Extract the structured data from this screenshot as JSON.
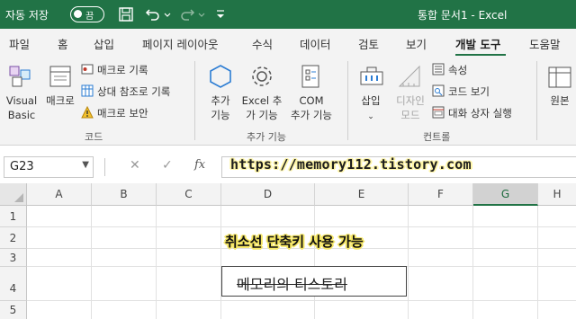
{
  "titlebar": {
    "autosave_label": "자동 저장",
    "toggle_state": "끔",
    "doc_title": "통합 문서1  -  Excel"
  },
  "tabs": [
    "파일",
    "홈",
    "삽입",
    "페이지 레이아웃",
    "수식",
    "데이터",
    "검토",
    "보기",
    "개발 도구",
    "도움말"
  ],
  "active_tab": "개발 도구",
  "ribbon": {
    "code": {
      "visual_basic": "Visual\nBasic",
      "macro": "매크로",
      "record_macro": "매크로 기록",
      "relative_ref": "상대 참조로 기록",
      "macro_security": "매크로 보안",
      "group_label": "코드"
    },
    "addins": {
      "addins": "추가\n기능",
      "excel_addins": "Excel 추\n가 기능",
      "com_addins": "COM\n추가 기능",
      "group_label": "추가 기능"
    },
    "controls": {
      "insert": "삽입",
      "design_mode": "디자인\n모드",
      "properties": "속성",
      "view_code": "코드 보기",
      "run_dialog": "대화 상자 실행",
      "group_label": "컨트롤"
    },
    "source": {
      "label": "원본"
    }
  },
  "formula_bar": {
    "name_box": "G23",
    "fx": "fx",
    "watermark": "https://memory112.tistory.com"
  },
  "sheet": {
    "columns": [
      "A",
      "B",
      "C",
      "D",
      "E",
      "F",
      "G",
      "H"
    ],
    "selected_column": "G",
    "rows": [
      "1",
      "2",
      "3",
      "4",
      "5"
    ],
    "caption": "취소선 단축키 사용 가능",
    "textbox_text": "메모리의 티스토리"
  },
  "colors": {
    "accent": "#217346",
    "highlight": "#f5e663"
  }
}
